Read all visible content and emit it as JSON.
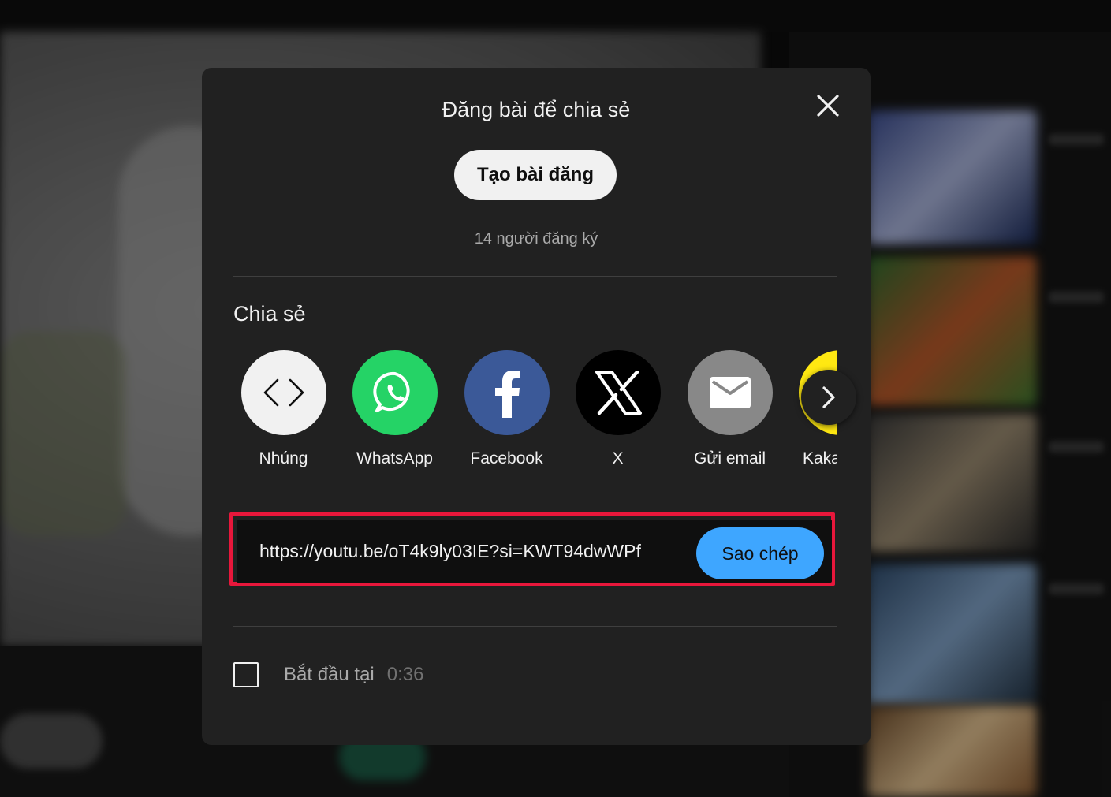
{
  "dialog": {
    "title": "Đăng bài để chia sẻ",
    "create_post_label": "Tạo bài đăng",
    "subscribers_text": "14 người đăng ký",
    "share_heading": "Chia sẻ",
    "share_targets": [
      {
        "label": "Nhúng",
        "icon": "embed-code-icon",
        "color": "#f1f1f1"
      },
      {
        "label": "WhatsApp",
        "icon": "whatsapp-icon",
        "color": "#25d366"
      },
      {
        "label": "Facebook",
        "icon": "facebook-icon",
        "color": "#3b5998"
      },
      {
        "label": "X",
        "icon": "x-logo-icon",
        "color": "#000000"
      },
      {
        "label": "Gửi email",
        "icon": "email-icon",
        "color": "#888888"
      },
      {
        "label": "Kaka",
        "icon": "kakaotalk-icon",
        "color": "#ffe812"
      }
    ],
    "share_url": "https://youtu.be/oT4k9ly03IE?si=KWT94dwWPf",
    "copy_label": "Sao chép",
    "start_at_label": "Bắt đầu tại",
    "start_at_time": "0:36",
    "start_at_checked": false,
    "highlight_color": "#e8173b"
  }
}
